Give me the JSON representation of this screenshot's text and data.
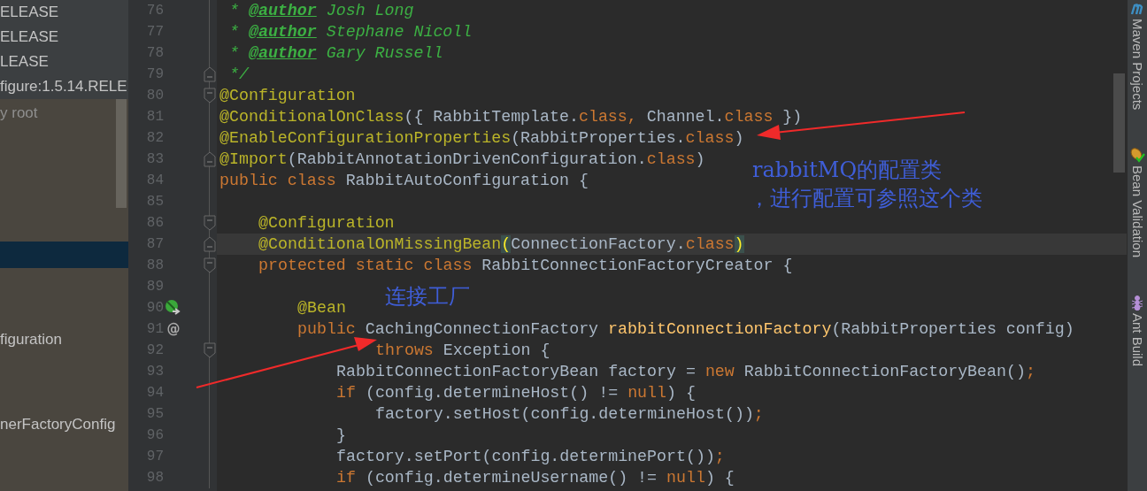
{
  "project_tree": {
    "top_items": [
      {
        "label": "ELEASE"
      },
      {
        "label": "ELEASE"
      },
      {
        "label": "LEASE"
      },
      {
        "label": "figure:1.5.14.RELE"
      }
    ],
    "items": [
      {
        "label": "y root",
        "dimmed": true,
        "selected": false
      },
      {
        "selected": true
      },
      {
        "label": "figuration",
        "dimmed": false,
        "selected": false
      },
      {
        "label": "nerFactoryConfig",
        "dimmed": false,
        "selected": false
      }
    ]
  },
  "editor": {
    "lines": [
      {
        "number": "76",
        "segments": [
          {
            "text": " * ",
            "kind": "comment"
          },
          {
            "text": "@author",
            "kind": "doc_tag"
          },
          {
            "text": " Josh Long",
            "kind": "comment"
          }
        ]
      },
      {
        "number": "77",
        "segments": [
          {
            "text": " * ",
            "kind": "comment"
          },
          {
            "text": "@author",
            "kind": "doc_tag"
          },
          {
            "text": " Stephane Nicoll",
            "kind": "comment"
          }
        ]
      },
      {
        "number": "78",
        "segments": [
          {
            "text": " * ",
            "kind": "comment"
          },
          {
            "text": "@author",
            "kind": "doc_tag"
          },
          {
            "text": " Gary Russell",
            "kind": "comment"
          }
        ]
      },
      {
        "number": "79",
        "fold": {
          "kind": "end"
        },
        "segments": [
          {
            "text": " */",
            "kind": "comment"
          }
        ]
      },
      {
        "number": "80",
        "fold": {
          "kind": "start"
        },
        "segments": [
          {
            "text": "@Configuration",
            "kind": "annotation"
          }
        ]
      },
      {
        "number": "81",
        "segments": [
          {
            "text": "@ConditionalOnClass",
            "kind": "annotation"
          },
          {
            "text": "({ RabbitTemplate.",
            "kind": "plain"
          },
          {
            "text": "class,",
            "kind": "keyword"
          },
          {
            "text": " Channel.",
            "kind": "plain"
          },
          {
            "text": "class",
            "kind": "keyword"
          },
          {
            "text": " })",
            "kind": "plain"
          }
        ]
      },
      {
        "number": "82",
        "segments": [
          {
            "text": "@EnableConfigurationProperties",
            "kind": "annotation"
          },
          {
            "text": "(RabbitProperties.",
            "kind": "plain"
          },
          {
            "text": "class",
            "kind": "keyword"
          },
          {
            "text": ")",
            "kind": "plain"
          }
        ]
      },
      {
        "number": "83",
        "fold": {
          "kind": "end"
        },
        "segments": [
          {
            "text": "@Import",
            "kind": "annotation"
          },
          {
            "text": "(RabbitAnnotationDrivenConfiguration.",
            "kind": "plain"
          },
          {
            "text": "class",
            "kind": "keyword"
          },
          {
            "text": ")",
            "kind": "plain"
          }
        ]
      },
      {
        "number": "84",
        "segments": [
          {
            "text": "public class",
            "kind": "keyword"
          },
          {
            "text": " RabbitAutoConfiguration {",
            "kind": "plain"
          }
        ]
      },
      {
        "number": "85"
      },
      {
        "number": "86",
        "fold": {
          "kind": "start"
        },
        "segments": [
          {
            "text": "    @Configuration",
            "kind": "annotation"
          }
        ]
      },
      {
        "number": "87",
        "fold": {
          "kind": "end"
        },
        "current": true,
        "segments": [
          {
            "text": "    @ConditionalOnMissingBean",
            "kind": "annotation"
          },
          {
            "text": "(",
            "kind": "brace_match"
          },
          {
            "text": "ConnectionFactory.",
            "kind": "plain"
          },
          {
            "text": "class",
            "kind": "keyword"
          },
          {
            "text": ")",
            "kind": "brace_match"
          }
        ]
      },
      {
        "number": "88",
        "fold": {
          "kind": "start"
        },
        "segments": [
          {
            "text": "    protected static class",
            "kind": "keyword"
          },
          {
            "text": " RabbitConnectionFactoryCreator {",
            "kind": "plain"
          }
        ]
      },
      {
        "number": "89"
      },
      {
        "number": "90",
        "marker": {
          "kind": "bean"
        },
        "segments": [
          {
            "text": "        @Bean",
            "kind": "annotation"
          }
        ]
      },
      {
        "number": "91",
        "marker": {
          "kind": "text",
          "text": "@"
        },
        "segments": [
          {
            "text": "        public",
            "kind": "keyword"
          },
          {
            "text": " CachingConnectionFactory ",
            "kind": "plain"
          },
          {
            "text": "rabbitConnectionFactory",
            "kind": "method"
          },
          {
            "text": "(RabbitProperties config)",
            "kind": "plain"
          }
        ]
      },
      {
        "number": "92",
        "fold": {
          "kind": "start"
        },
        "segments": [
          {
            "text": "                throws",
            "kind": "keyword"
          },
          {
            "text": " Exception {",
            "kind": "plain"
          }
        ]
      },
      {
        "number": "93",
        "segments": [
          {
            "text": "            RabbitConnectionFactoryBean factory = ",
            "kind": "plain"
          },
          {
            "text": "new",
            "kind": "keyword"
          },
          {
            "text": " RabbitConnectionFactoryBean()",
            "kind": "plain"
          },
          {
            "text": ";",
            "kind": "keyword"
          }
        ]
      },
      {
        "number": "94",
        "segments": [
          {
            "text": "            if",
            "kind": "keyword"
          },
          {
            "text": " (config.determineHost() != ",
            "kind": "plain"
          },
          {
            "text": "null",
            "kind": "keyword"
          },
          {
            "text": ") {",
            "kind": "plain"
          }
        ]
      },
      {
        "number": "95",
        "segments": [
          {
            "text": "                factory.setHost(config.determineHost())",
            "kind": "plain"
          },
          {
            "text": ";",
            "kind": "keyword"
          }
        ]
      },
      {
        "number": "96",
        "segments": [
          {
            "text": "            }",
            "kind": "plain"
          }
        ]
      },
      {
        "number": "97",
        "segments": [
          {
            "text": "            factory.setPort(config.determinePort())",
            "kind": "plain"
          },
          {
            "text": ";",
            "kind": "keyword"
          }
        ]
      },
      {
        "number": "98",
        "segments": [
          {
            "text": "            if",
            "kind": "keyword"
          },
          {
            "text": " (config.determineUsername() != ",
            "kind": "plain"
          },
          {
            "text": "null",
            "kind": "keyword"
          },
          {
            "text": ") {",
            "kind": "plain"
          }
        ]
      }
    ]
  },
  "annotations": [
    {
      "text": "rabbitMQ的配置类"
    },
    {
      "text": "，进行配置可参照这个类"
    },
    {
      "text": "连接工厂"
    }
  ],
  "tool_stripe": [
    {
      "label": "Maven Projects",
      "kind": "maven"
    },
    {
      "label": "Bean Validation",
      "kind": "bean"
    },
    {
      "label": "Ant Build",
      "kind": "ant"
    }
  ]
}
